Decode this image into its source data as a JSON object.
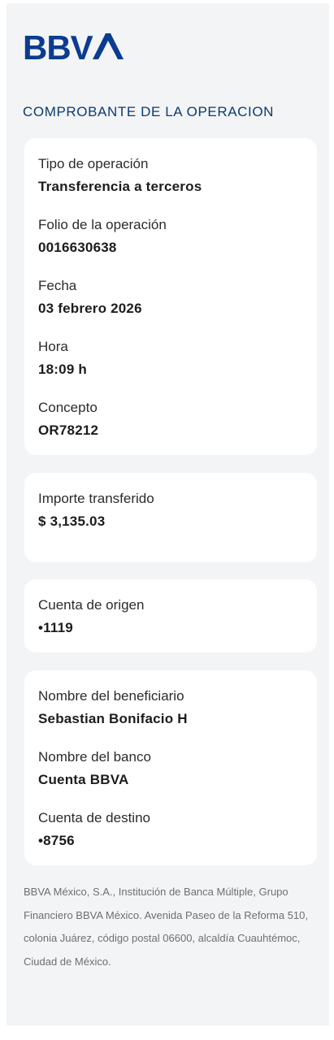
{
  "brand": {
    "name": "BBVA",
    "color": "#0b3c8f"
  },
  "receipt_title": "COMPROBANTE DE LA OPERACION",
  "operation": {
    "type_label": "Tipo de operación",
    "type_value": "Transferencia a terceros",
    "folio_label": "Folio de la operación",
    "folio_value": "0016630638",
    "date_label": "Fecha",
    "date_value": "03 febrero 2026",
    "time_label": "Hora",
    "time_value": "18:09 h",
    "concept_label": "Concepto",
    "concept_value": "OR78212"
  },
  "amount": {
    "label": "Importe transferido",
    "value": "$ 3,135.03"
  },
  "origin": {
    "label": "Cuenta de origen",
    "value": "•1119"
  },
  "beneficiary": {
    "name_label": "Nombre del beneficiario",
    "name_value": "Sebastian Bonifacio H",
    "bank_label": "Nombre del banco",
    "bank_value": "Cuenta BBVA",
    "dest_label": "Cuenta de destino",
    "dest_value": "•8756"
  },
  "footer_text": "BBVA México, S.A., Institución de Banca Múltiple, Grupo Financiero BBVA México. Avenida Paseo de la Reforma 510, colonia Juárez, código postal 06600, alcaldía Cuauhtémoc, Ciudad de México."
}
